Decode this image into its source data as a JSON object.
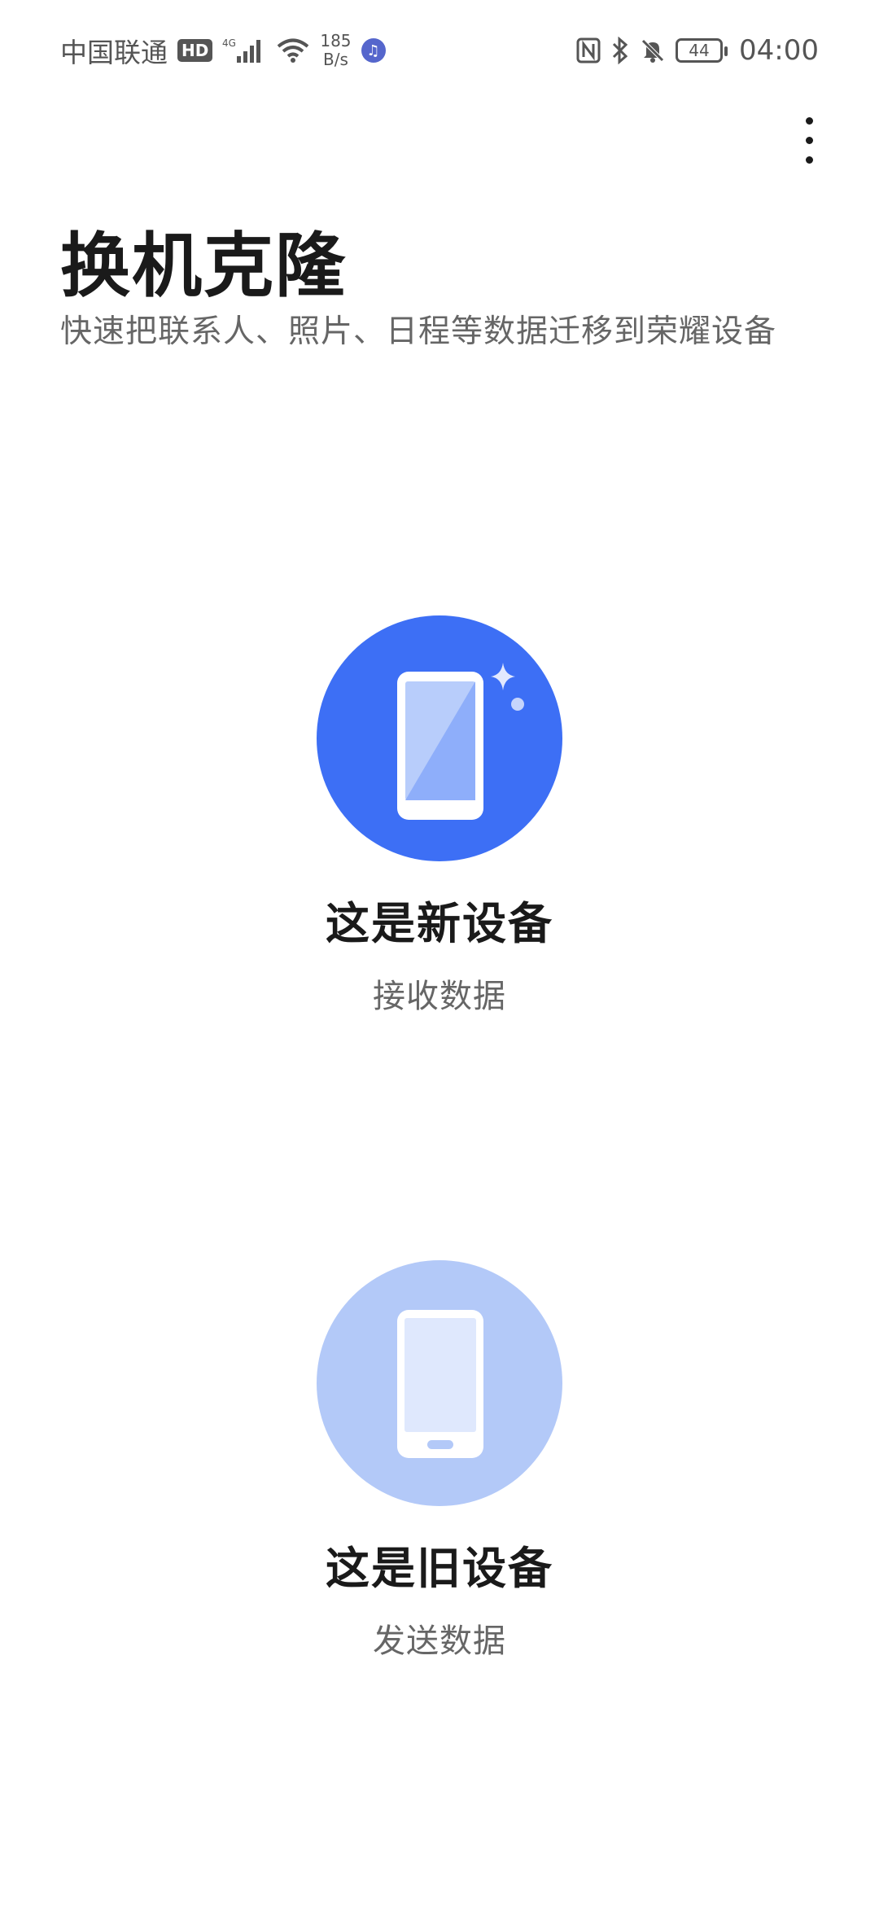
{
  "status_bar": {
    "carrier": "中国联通",
    "hd_label": "HD",
    "network_type": "4G",
    "speed_value": "185",
    "speed_unit": "B/s",
    "battery_level": "44",
    "time": "04:00"
  },
  "header": {
    "title": "换机克隆",
    "subtitle": "快速把联系人、照片、日程等数据迁移到荣耀设备"
  },
  "options": {
    "new_device": {
      "title": "这是新设备",
      "subtitle": "接收数据"
    },
    "old_device": {
      "title": "这是旧设备",
      "subtitle": "发送数据"
    }
  },
  "colors": {
    "new_device_circle": "#3d6ff5",
    "old_device_circle": "#b3c9f8"
  },
  "icons": {
    "menu": "more-vertical-icon",
    "new_device": "new-phone-sparkle-icon",
    "old_device": "old-phone-icon"
  }
}
